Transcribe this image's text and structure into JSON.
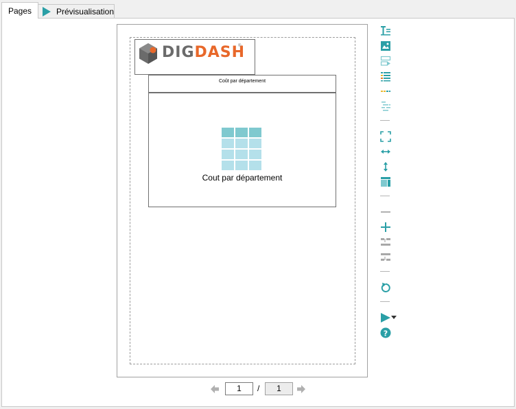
{
  "tabs": {
    "pages": "Pages",
    "preview": "Prévisualisation"
  },
  "logo": {
    "text_part1": "DIG",
    "text_part2": "DASH",
    "registered": "®"
  },
  "chart": {
    "title": "Coût par département",
    "label": "Cout par département"
  },
  "pager": {
    "current_page": "1",
    "separator": "/",
    "total_pages": "1"
  },
  "toolbar": {
    "icons": [
      "text-icon",
      "image-icon",
      "form-icon",
      "list-icon",
      "separator-line-icon",
      "table-layout-icon",
      "fit-page-icon",
      "fit-width-icon",
      "fit-height-icon",
      "columns-icon",
      "remove-icon",
      "add-icon",
      "move-up-icon",
      "move-down-icon",
      "refresh-icon",
      "play-icon",
      "dropdown-arrow-icon",
      "help-icon"
    ]
  },
  "colors": {
    "accent": "#2a9fa6",
    "teal_light": "#b4e0ea",
    "teal_dark": "#7fc9cf",
    "logo_gray": "#6b6b6b",
    "logo_orange": "#e8682a",
    "bar_yellow": "#e8b830",
    "bar_orange": "#e07a2b"
  }
}
